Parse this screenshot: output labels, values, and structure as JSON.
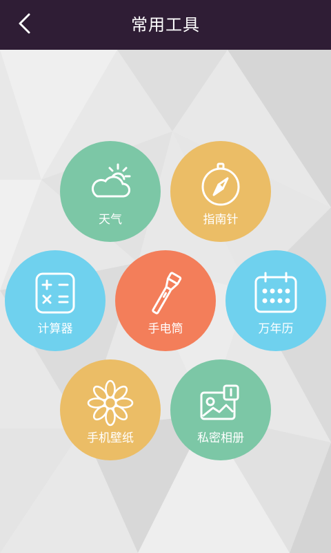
{
  "header": {
    "title": "常用工具",
    "back_icon": "chevron-left-icon",
    "background": "#2f1d35"
  },
  "tools": [
    {
      "label": "天气",
      "icon": "weather-icon",
      "color": "#7cc7a6"
    },
    {
      "label": "指南针",
      "icon": "compass-icon",
      "color": "#ebbd66"
    },
    {
      "label": "计算器",
      "icon": "calculator-icon",
      "color": "#6fd1ee"
    },
    {
      "label": "手电筒",
      "icon": "flashlight-icon",
      "color": "#f37e5a"
    },
    {
      "label": "万年历",
      "icon": "calendar-icon",
      "color": "#6fd1ee"
    },
    {
      "label": "手机壁纸",
      "icon": "flower-icon",
      "color": "#ebbd66"
    },
    {
      "label": "私密相册",
      "icon": "photo-album-icon",
      "color": "#7cc7a6"
    }
  ]
}
